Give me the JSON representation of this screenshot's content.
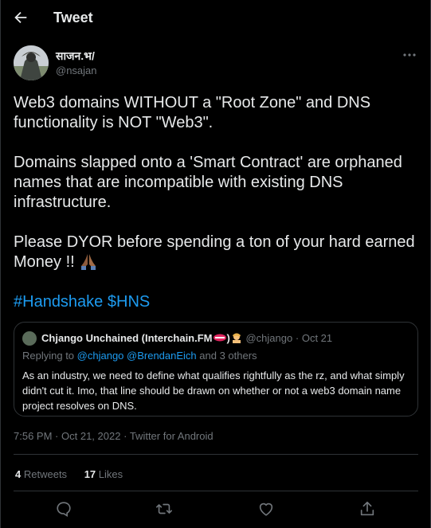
{
  "header": {
    "title": "Tweet"
  },
  "author": {
    "display_name": "साजन.भ/",
    "handle": "@nsajan"
  },
  "tweet": {
    "paragraphs": [
      "Web3 domains WITHOUT a \"Root Zone\" and DNS functionality is NOT \"Web3\".",
      "Domains slapped onto a  'Smart Contract' are orphaned names that are incompatible with existing DNS infrastructure.",
      "Please DYOR before spending a ton of your hard earned Money !!"
    ],
    "hashtags": [
      "#Handshake",
      "$HNS"
    ]
  },
  "quote": {
    "name": "Chjango Unchained (Interchain.FM",
    "name_suffix": ")",
    "handle": "@chjango",
    "date": "Oct 21",
    "replying_prefix": "Replying to",
    "replying_mentions": "@chjango @BrendanEich",
    "replying_suffix": "and 3 others",
    "text": "As an industry, we need to define what qualifies rightfully as the rz, and what simply didn't cut it. Imo, that line should be drawn on whether or not a web3 domain name project resolves on DNS."
  },
  "meta": {
    "time": "7:56 PM",
    "date": "Oct 21, 2022",
    "separator": "·",
    "source": "Twitter for Android"
  },
  "stats": {
    "retweets_count": "4",
    "retweets_label": "Retweets",
    "likes_count": "17",
    "likes_label": "Likes"
  },
  "colors": {
    "background": "#000000",
    "text": "#e7e9ea",
    "secondary": "#71767b",
    "accent": "#1d9bf0",
    "border": "#2f3336"
  },
  "icons": {
    "back": "arrow-left-icon",
    "more": "more-horizontal-icon",
    "reply": "reply-icon",
    "retweet": "retweet-icon",
    "like": "heart-icon",
    "share": "share-icon"
  }
}
